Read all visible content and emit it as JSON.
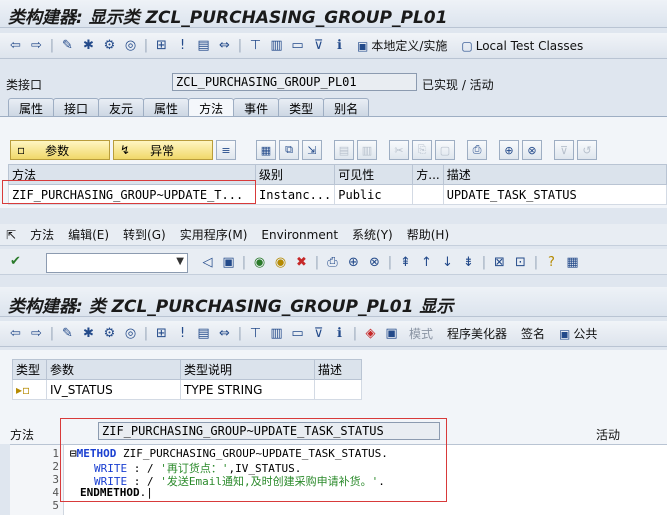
{
  "top": {
    "title": "类构建器: 显示类 ZCL_PURCHASING_GROUP_PL01",
    "toolbar_local_def": "本地定义/实施",
    "toolbar_local_test": "Local Test Classes",
    "class_label": "类接口",
    "class_value": "ZCL_PURCHASING_GROUP_PL01",
    "class_status": "已实现 / 活动",
    "tabs": [
      "属性",
      "接口",
      "友元",
      "属性",
      "方法",
      "事件",
      "类型",
      "别名"
    ],
    "btn_params": "参数",
    "btn_exceptions": "异常",
    "table": {
      "headers": [
        "方法",
        "级别",
        "可见性",
        "方...",
        "描述"
      ],
      "row": [
        "ZIF_PURCHASING_GROUP~UPDATE_T...",
        "Instanc...",
        "Public",
        "",
        "UPDATE_TASK_STATUS"
      ]
    }
  },
  "bottom": {
    "menu": [
      "方法",
      "编辑(E)",
      "转到(G)",
      "实用程序(M)",
      "Environment",
      "系统(Y)",
      "帮助(H)"
    ],
    "title": "类构建器: 类 ZCL_PURCHASING_GROUP_PL01 显示",
    "toolbar_mode": "模式",
    "toolbar_beautify": "程序美化器",
    "toolbar_sign": "签名",
    "toolbar_public": "公共",
    "params": {
      "headers": [
        "类型",
        "参数",
        "类型说明",
        "描述"
      ],
      "row": [
        "",
        "IV_STATUS",
        "TYPE STRING",
        ""
      ]
    },
    "method_label": "方法",
    "method_value": "ZIF_PURCHASING_GROUP~UPDATE_TASK_STATUS",
    "method_status": "活动",
    "code": {
      "line_numbers": [
        "1",
        "2",
        "3",
        "4",
        "5"
      ],
      "l1_kw": "METHOD",
      "l1_rest": " ZIF_PURCHASING_GROUP~UPDATE_TASK_STATUS.",
      "l2_kw": "WRITE",
      "l2_mid": " : / ",
      "l2_str": "'再订货点：'",
      "l2_rest": ",IV_STATUS.",
      "l3_kw": "WRITE",
      "l3_mid": " : / ",
      "l3_str": "'发送Email通知,及时创建采购申请补货。'",
      "l3_rest": ".",
      "l4_kw": "ENDMETHOD",
      "l4_rest": "."
    }
  },
  "colors": {
    "highlight_box": "#d83a3a",
    "title_bg": "#dce4ee",
    "button_yellow": "#f0d86a"
  }
}
